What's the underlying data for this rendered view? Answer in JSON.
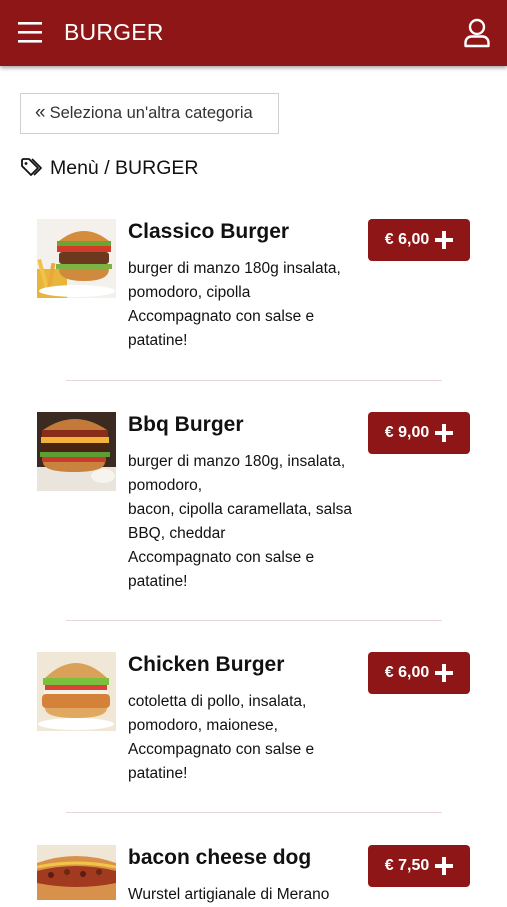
{
  "header": {
    "title": "BURGER",
    "menu_icon": "hamburger-menu-icon",
    "user_icon": "user-account-icon",
    "background": "#8e1616"
  },
  "back_button": {
    "chevron": "«",
    "label": "Seleziona un'altra categoria"
  },
  "breadcrumb": {
    "icon": "tags-icon",
    "text": "Menù / BURGER"
  },
  "items": [
    {
      "name": "Classico Burger",
      "description": [
        "burger di manzo 180g insalata,",
        "pomodoro, cipolla",
        "Accompagnato con salse e",
        "patatine!"
      ],
      "price": "€ 6,00"
    },
    {
      "name": "Bbq Burger",
      "description": [
        "burger di manzo 180g, insalata,",
        "pomodoro,",
        "bacon, cipolla caramellata, salsa",
        "BBQ, cheddar",
        "Accompagnato con salse e",
        "patatine!"
      ],
      "price": "€ 9,00"
    },
    {
      "name": "Chicken Burger",
      "description": [
        "cotoletta di pollo, insalata,",
        "pomodoro, maionese,",
        "Accompagnato con salse e",
        "patatine!"
      ],
      "price": "€ 6,00"
    },
    {
      "name": "bacon cheese dog",
      "description": [
        "Wurstel artigianale di Merano"
      ],
      "price": "€ 7,50"
    }
  ]
}
